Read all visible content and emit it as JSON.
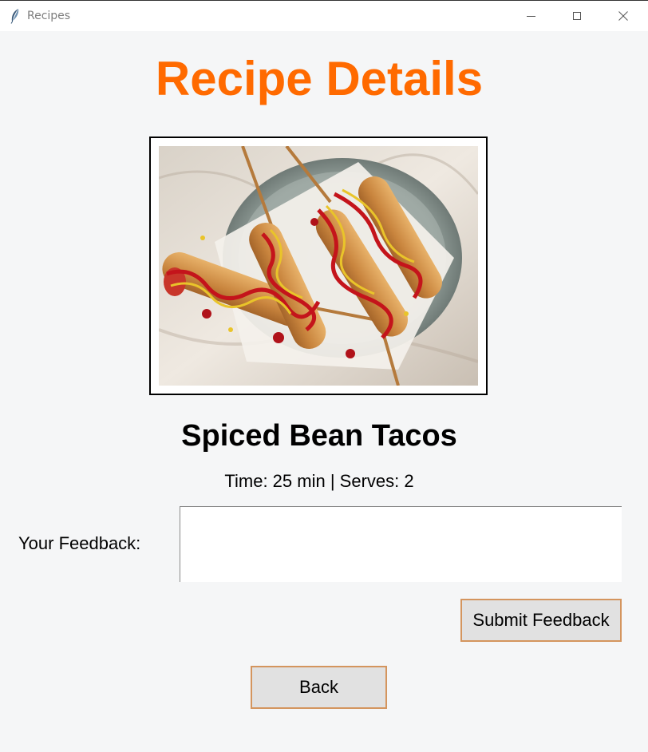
{
  "window": {
    "title": "Recipes",
    "icon": "feather-icon"
  },
  "page": {
    "heading": "Recipe Details",
    "heading_color": "#ff6a00"
  },
  "recipe": {
    "name": "Spiced Bean Tacos",
    "meta": "Time: 25 min | Serves: 2",
    "image_alt": "corn dogs on a plate"
  },
  "feedback": {
    "label": "Your Feedback:",
    "value": "",
    "placeholder": "",
    "submit_label": "Submit Feedback"
  },
  "nav": {
    "back_label": "Back"
  },
  "colors": {
    "button_border": "#d4955e",
    "button_bg": "#e1e1e1",
    "background": "#f5f6f7"
  }
}
